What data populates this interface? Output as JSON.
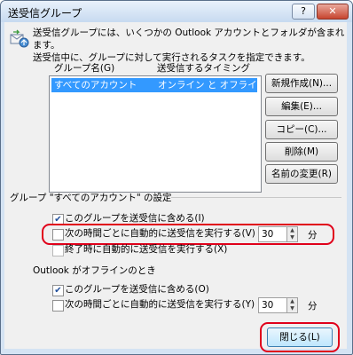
{
  "window": {
    "title": "送受信グループ",
    "help_button": "?",
    "close_button": "✕"
  },
  "intro": {
    "line1": "送受信グループには、いくつかの Outlook アカウントとフォルダが含まれます。",
    "line2": "送受信中に、グループに対して実行されるタスクを指定できます。"
  },
  "list": {
    "col_group_name": "グループ名(G)",
    "col_timing": "送受信するタイミング",
    "rows": [
      {
        "name": "すべてのアカウント",
        "timing": "オンライン と オフライン"
      }
    ]
  },
  "buttons": {
    "new": "新規作成(N)...",
    "edit": "編集(E)...",
    "copy": "コピー(C)...",
    "delete": "削除(M)",
    "rename": "名前の変更(R)"
  },
  "settings": {
    "section_title": "グループ \"すべてのアカウント\" の設定",
    "online_include": "このグループを送受信に含める(I)",
    "online_include_checked": true,
    "online_auto": "次の時間ごとに自動的に送受信を実行する(V)",
    "online_auto_checked": false,
    "online_minutes": "30",
    "online_unit": "分",
    "on_exit": "終了時に自動的に送受信を実行する(X)",
    "on_exit_checked": false,
    "offline_title": "Outlook がオフラインのとき",
    "offline_include": "このグループを送受信に含める(O)",
    "offline_include_checked": true,
    "offline_auto": "次の時間ごとに自動的に送受信を実行する(Y)",
    "offline_auto_checked": false,
    "offline_minutes": "30",
    "offline_unit": "分"
  },
  "footer": {
    "close": "閉じる(L)"
  },
  "colors": {
    "highlight": "#e0001a",
    "selection": "#3399ff"
  }
}
